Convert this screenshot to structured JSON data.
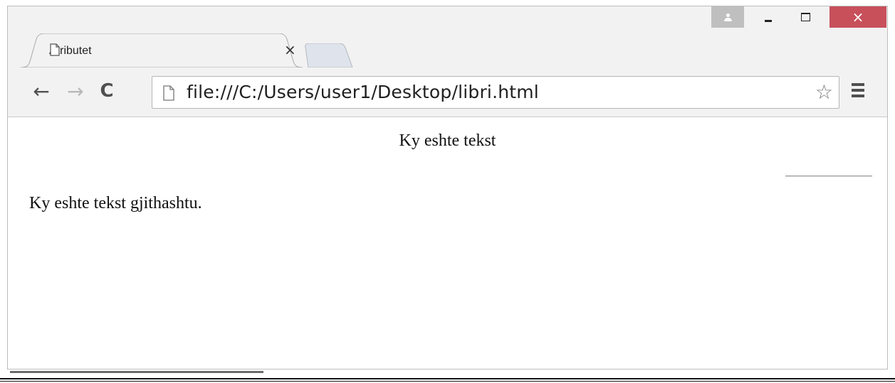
{
  "tab": {
    "title": "Atributet",
    "close": "×"
  },
  "window_controls": {
    "close": "×"
  },
  "toolbar": {
    "back": "←",
    "forward": "→",
    "reload": "C",
    "url": "file:///C:/Users/user1/Desktop/libri.html",
    "star": "☆"
  },
  "content": {
    "centered_text": "Ky eshte tekst",
    "paragraph": "Ky eshte tekst gjithashtu."
  }
}
